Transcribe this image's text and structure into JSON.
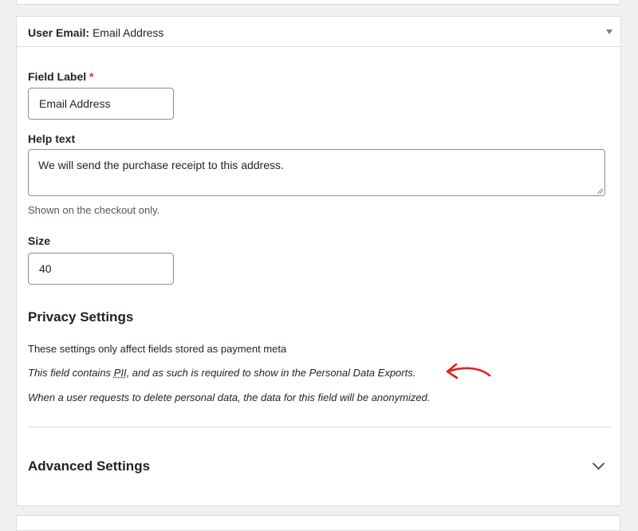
{
  "header": {
    "field_type": "User Email",
    "separator": ":",
    "field_name": "Email Address"
  },
  "field_label": {
    "label": "Field Label",
    "required_mark": "*",
    "value": "Email Address"
  },
  "help_text": {
    "label": "Help text",
    "value": "We will send the purchase receipt to this address.",
    "description": "Shown on the checkout only."
  },
  "size": {
    "label": "Size",
    "value": "40"
  },
  "privacy": {
    "heading": "Privacy Settings",
    "line1": "These settings only affect fields stored as payment meta",
    "line2_prefix": "This field contains ",
    "line2_abbr": "PII",
    "line2_suffix": ", and as such is required to show in the Personal Data Exports.",
    "line3": "When a user requests to delete personal data, the data for this field will be anonymized."
  },
  "advanced": {
    "heading": "Advanced Settings"
  },
  "colors": {
    "annotation_arrow": "#e0201b",
    "required": "#d63638"
  }
}
